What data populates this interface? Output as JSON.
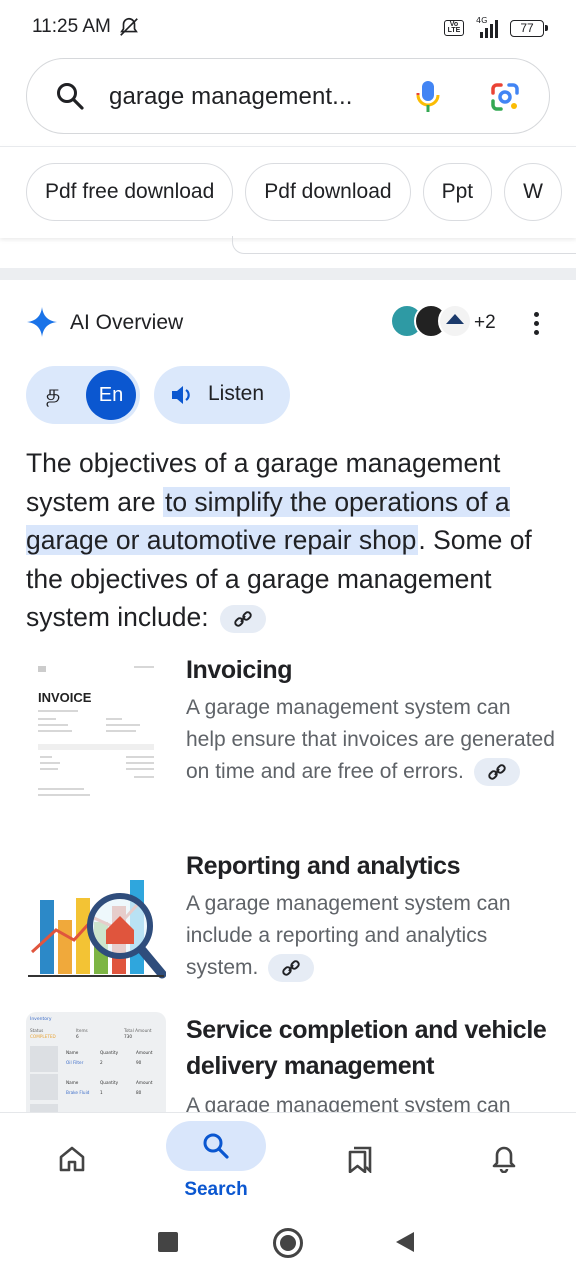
{
  "status_bar": {
    "time": "11:25 AM",
    "network_type": "4G",
    "volte": "Vo LTE",
    "battery": "77",
    "icons": [
      "alarm-off-icon",
      "signal-icon",
      "battery-icon"
    ]
  },
  "search": {
    "query": "garage management...",
    "icons": [
      "search-icon",
      "mic-icon",
      "lens-icon"
    ],
    "colors": {
      "mic_blue": "#4285f4",
      "mic_red": "#ea4335",
      "mic_yellow": "#fbbc04",
      "mic_green": "#34a853"
    }
  },
  "chips": [
    "Pdf free download",
    "Pdf download",
    "Ppt",
    "W"
  ],
  "ai_overview": {
    "title": "AI Overview",
    "extra_sources": "+2",
    "lang_ta": "த",
    "lang_en": "En",
    "listen": "Listen",
    "summary_before": "The objectives of a garage management system are ",
    "summary_highlight": "to simplify the operations of a garage or automotive repair shop",
    "summary_after": ". Some of the objectives of a garage management system include:",
    "accent": "#0b57d0",
    "highlight_bg": "#d9e6fb"
  },
  "items": [
    {
      "title": "Invoicing",
      "body": "A garage management system can help ensure that invoices are generated on time and are free of errors.",
      "thumb_text": "INVOICE"
    },
    {
      "title": "Reporting and analytics",
      "body": "A garage management system can include a reporting and analytics system."
    },
    {
      "title": "Service completion and vehicle delivery management",
      "body": "A garage management system can"
    }
  ],
  "inventory_thumb": {
    "heading": "Inventory",
    "status_label": "Status",
    "status_value": "COMPLETED",
    "items_label": "Items",
    "items_value": "6",
    "total_label": "Total Amount",
    "total_value": "730",
    "col_name": "Name",
    "col_qty": "Quantity",
    "col_amount": "Amount",
    "row1_name": "Oil Filter",
    "row1_qty": "2",
    "row1_amount": "90",
    "row2_name": "Brake Fluid",
    "row2_qty": "1",
    "row2_amount": "80"
  },
  "bottom_nav": {
    "search_label": "Search"
  }
}
